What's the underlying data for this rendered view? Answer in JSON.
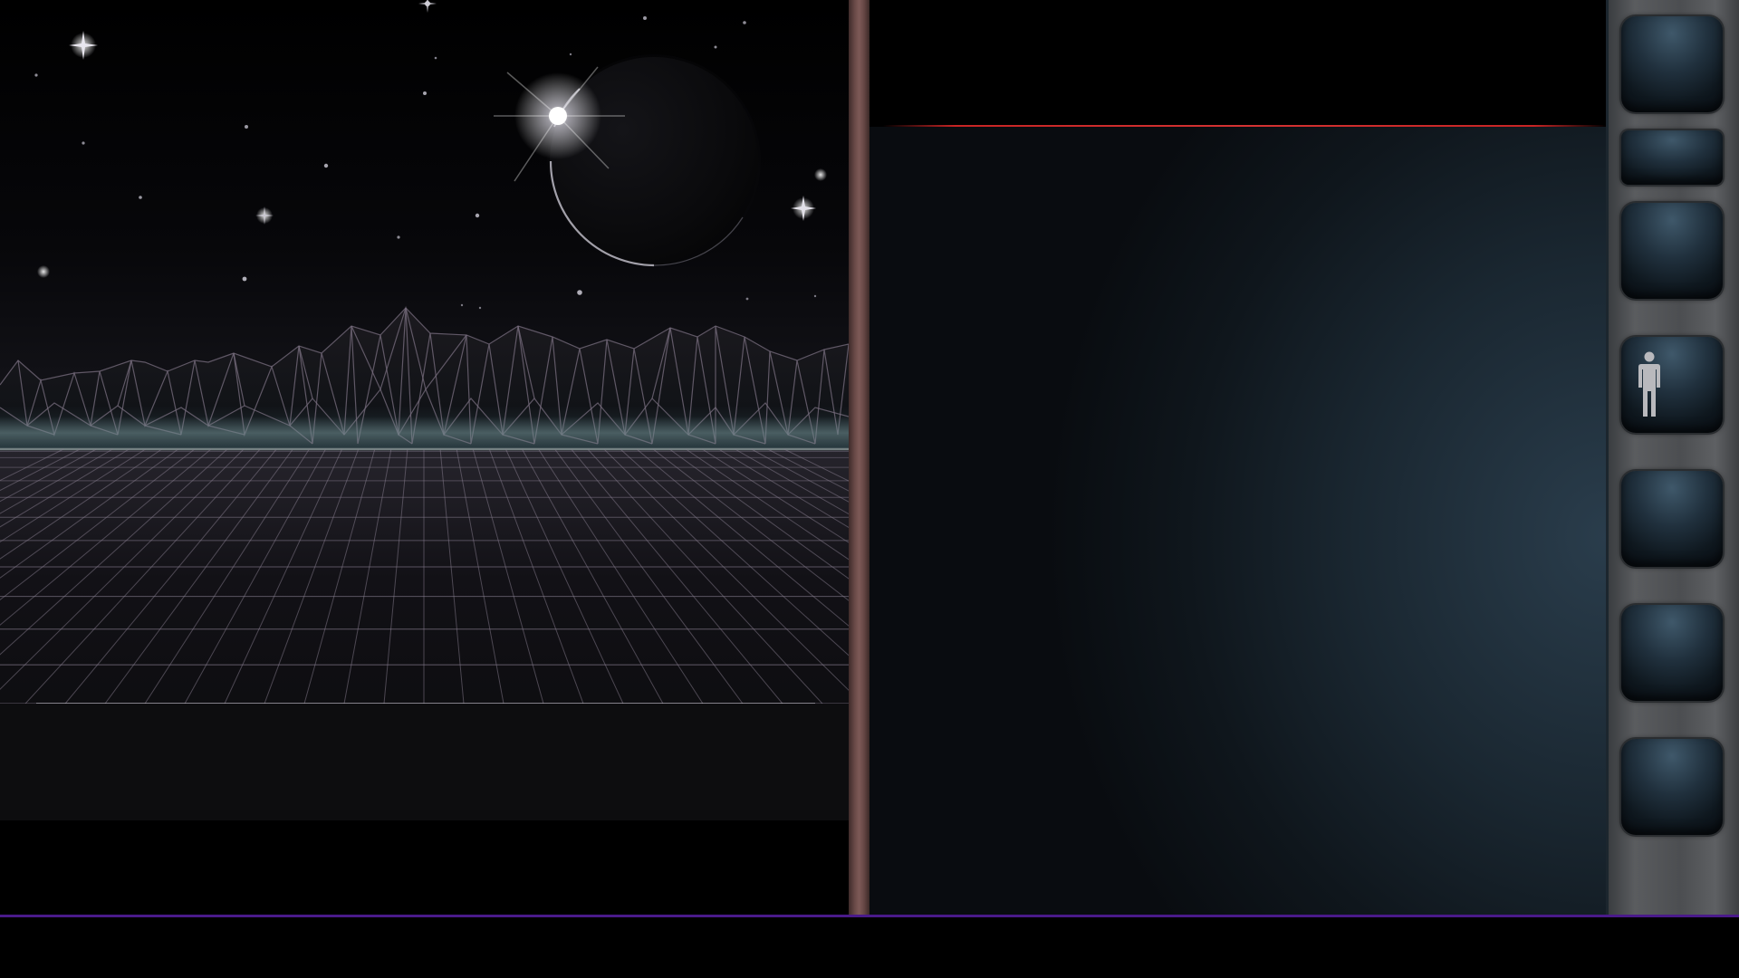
{
  "colors": {
    "background": "#000000",
    "divider": "#6a4a48",
    "accent_red": "#d43232",
    "accent_purple": "#4a1a8a",
    "panel_teal": "#2a3d4c",
    "grid_line": "#8a7f92",
    "sidebar_metal": "#55575a"
  },
  "sidebar": {
    "buttons": [
      {
        "id": "slot-1",
        "icon": ""
      },
      {
        "id": "slot-2",
        "icon": ""
      },
      {
        "id": "slot-3",
        "icon": ""
      },
      {
        "id": "slot-4",
        "icon": "person-icon"
      },
      {
        "id": "slot-5",
        "icon": ""
      },
      {
        "id": "slot-6",
        "icon": ""
      },
      {
        "id": "slot-7",
        "icon": ""
      }
    ]
  }
}
